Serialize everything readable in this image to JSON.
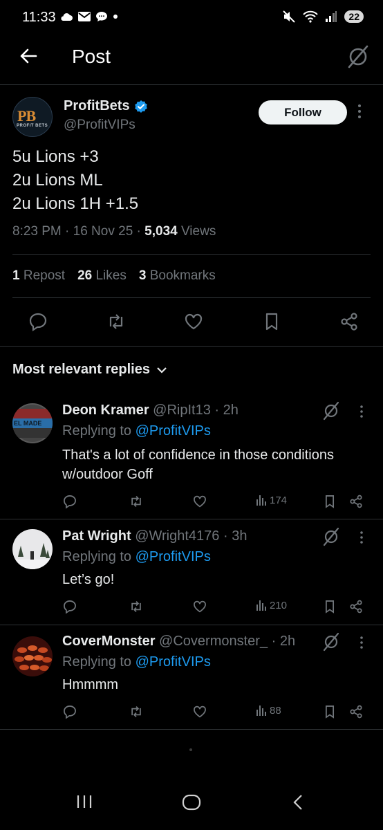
{
  "status_bar": {
    "time": "11:33",
    "battery": "22"
  },
  "header": {
    "title": "Post"
  },
  "post": {
    "author_name": "ProfitBets",
    "author_handle": "@ProfitVIPs",
    "avatar_text": "PB",
    "avatar_subtext": "PROFIT BETS",
    "follow_label": "Follow",
    "lines": [
      "5u Lions +3",
      "2u Lions ML",
      "2u Lions 1H +1.5"
    ],
    "time": "8:23 PM · 16 Nov 25 · ",
    "views_count": "5,034",
    "views_label": " Views",
    "reposts_count": "1",
    "reposts_label": "Repost",
    "likes_count": "26",
    "likes_label": "Likes",
    "bookmarks_count": "3",
    "bookmarks_label": "Bookmarks"
  },
  "replies_header": {
    "label": "Most relevant replies"
  },
  "replies": [
    {
      "name": "Deon Kramer",
      "handle": "@RipIt13 · 2h",
      "replying_prefix": "Replying to ",
      "replying_handle": "@ProfitVIPs",
      "text": "That's a lot of confidence in those conditions w/outdoor Goff",
      "views": "174",
      "avatar_text": "EL MADE"
    },
    {
      "name": "Pat Wright",
      "handle": "@Wright4176 · 3h",
      "replying_prefix": "Replying to ",
      "replying_handle": "@ProfitVIPs",
      "text": "Let’s go!",
      "views": "210"
    },
    {
      "name": "CoverMonster",
      "handle": "@Covermonster_ · 2h",
      "replying_prefix": "Replying to ",
      "replying_handle": "@ProfitVIPs",
      "text": "Hmmmm",
      "views": "88"
    }
  ],
  "colors": {
    "accent": "#1d9bf0",
    "muted": "#71767b",
    "text": "#e7e9ea",
    "background": "#000000",
    "divider": "#2f3336"
  }
}
